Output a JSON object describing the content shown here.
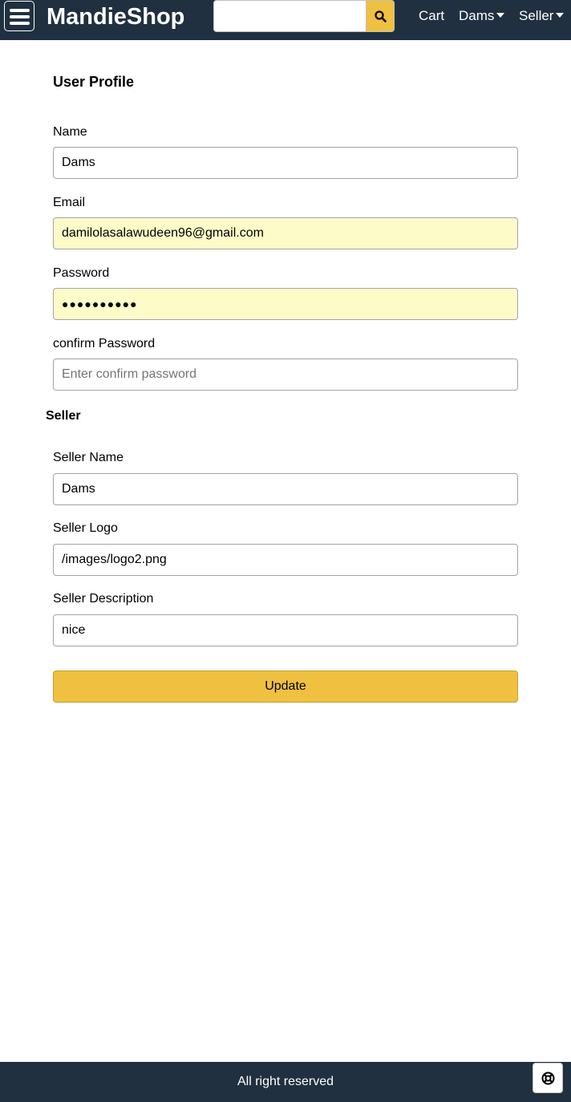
{
  "header": {
    "brand": "MandieShop",
    "search": {
      "value": "",
      "placeholder": ""
    },
    "cart": "Cart",
    "user_menu": "Dams",
    "seller_menu": "Seller"
  },
  "profile": {
    "title": "User Profile",
    "name": {
      "label": "Name",
      "value": "Dams"
    },
    "email": {
      "label": "Email",
      "value": "damilolasalawudeen96@gmail.com"
    },
    "password": {
      "label": "Password",
      "value": "●●●●●●●●●●"
    },
    "confirm_password": {
      "label": "confirm Password",
      "placeholder": "Enter confirm password"
    }
  },
  "seller": {
    "section_title": "Seller",
    "seller_name": {
      "label": "Seller Name",
      "value": "Dams"
    },
    "seller_logo": {
      "label": "Seller Logo",
      "value": "/images/logo2.png"
    },
    "seller_description": {
      "label": "Seller Description",
      "value": "nice"
    }
  },
  "update_button": "Update",
  "footer": {
    "text": "All right reserved"
  },
  "icons": {
    "menu": "hamburger-icon",
    "search": "search-icon",
    "help": "lifebuoy-icon"
  },
  "colors": {
    "header_bg": "#203040",
    "accent": "#f0c040",
    "autofill_bg": "#fdfbc8"
  }
}
